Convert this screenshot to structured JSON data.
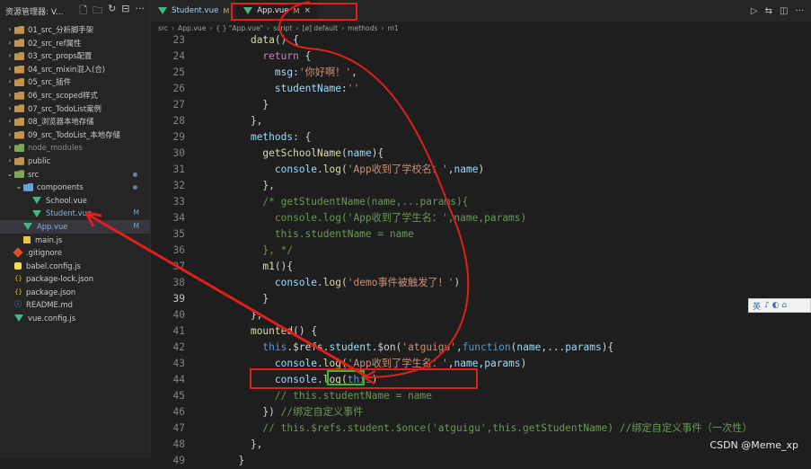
{
  "sidebar": {
    "title": "资源管理器: V...",
    "items": [
      {
        "label": "01_src_分析脚手架",
        "type": "folder"
      },
      {
        "label": "02_src_ref属性",
        "type": "folder"
      },
      {
        "label": "03_src_props配置",
        "type": "folder"
      },
      {
        "label": "04_src_mixin混入(合)",
        "type": "folder"
      },
      {
        "label": "05_src_插件",
        "type": "folder"
      },
      {
        "label": "06_src_scoped样式",
        "type": "folder"
      },
      {
        "label": "07_src_TodoList案例",
        "type": "folder"
      },
      {
        "label": "08_浏览器本地存储",
        "type": "folder"
      },
      {
        "label": "09_src_TodoList_本地存储",
        "type": "folder"
      },
      {
        "label": "node_modules",
        "type": "folder-dim"
      },
      {
        "label": "public",
        "type": "folder"
      },
      {
        "label": "src",
        "type": "folder-open"
      },
      {
        "label": "components",
        "type": "folder-open"
      },
      {
        "label": "School.vue",
        "type": "vue"
      },
      {
        "label": "Student.vue",
        "type": "vue",
        "badge": "M"
      },
      {
        "label": "App.vue",
        "type": "vue",
        "badge": "M"
      },
      {
        "label": "main.js",
        "type": "js"
      },
      {
        "label": ".gitignore",
        "type": "git"
      },
      {
        "label": "babel.config.js",
        "type": "babel"
      },
      {
        "label": "package-lock.json",
        "type": "json"
      },
      {
        "label": "package.json",
        "type": "json"
      },
      {
        "label": "README.md",
        "type": "md"
      },
      {
        "label": "vue.config.js",
        "type": "vue"
      }
    ]
  },
  "tabs": [
    {
      "label": "Student.vue",
      "badge": "M"
    },
    {
      "label": "App.vue",
      "badge": "M",
      "close": "×"
    }
  ],
  "breadcrumb": [
    "src",
    "›",
    "App.vue",
    "›",
    "{ } \"App.vue\"",
    "›",
    "script",
    "›",
    "[ø] default",
    "›",
    "methods",
    "›",
    "m1"
  ],
  "editor": {
    "current_line": "39",
    "lines": [
      {
        "n": "23",
        "t": "    data() {"
      },
      {
        "n": "24",
        "t": "      return {"
      },
      {
        "n": "25",
        "t": "        msg:'你好啊！',"
      },
      {
        "n": "26",
        "t": "        studentName:''"
      },
      {
        "n": "27",
        "t": "      }"
      },
      {
        "n": "28",
        "t": "    },"
      },
      {
        "n": "29",
        "t": "    methods: {"
      },
      {
        "n": "30",
        "t": "      getSchoolName(name){"
      },
      {
        "n": "31",
        "t": "        console.log('App收到了学校名：',name)"
      },
      {
        "n": "32",
        "t": "      },"
      },
      {
        "n": "33",
        "t": "      /* getStudentName(name,...params){"
      },
      {
        "n": "34",
        "t": "        console.log('App收到了学生名：',name,params)"
      },
      {
        "n": "35",
        "t": "        this.studentName = name"
      },
      {
        "n": "36",
        "t": "      }, */"
      },
      {
        "n": "37",
        "t": "      m1(){"
      },
      {
        "n": "38",
        "t": "        console.log('demo事件被触发了！')"
      },
      {
        "n": "39",
        "t": "      }"
      },
      {
        "n": "40",
        "t": "    },"
      },
      {
        "n": "41",
        "t": "    mounted() {"
      },
      {
        "n": "42",
        "t": "      this.$refs.student.$on('atguigu',function(name,...params){"
      },
      {
        "n": "43",
        "t": "        console.log('App收到了学生名：',name,params)"
      },
      {
        "n": "44",
        "t": "        console.log(this)"
      },
      {
        "n": "45",
        "t": "        // this.studentName = name"
      },
      {
        "n": "46",
        "t": "      }) //绑定自定义事件"
      },
      {
        "n": "47",
        "t": "      // this.$refs.student.$once('atguigu',this.getStudentName) //绑定自定义事件（一次性）"
      },
      {
        "n": "48",
        "t": "    },"
      },
      {
        "n": "49",
        "t": "  }"
      }
    ]
  },
  "ime": {
    "label": "英",
    "extra": "♪ ◐ ⌂"
  },
  "watermark": "CSDN @Meme_xp",
  "colors": {
    "annotation": "#e0201b",
    "highlight_box": "#2fbf2f"
  }
}
